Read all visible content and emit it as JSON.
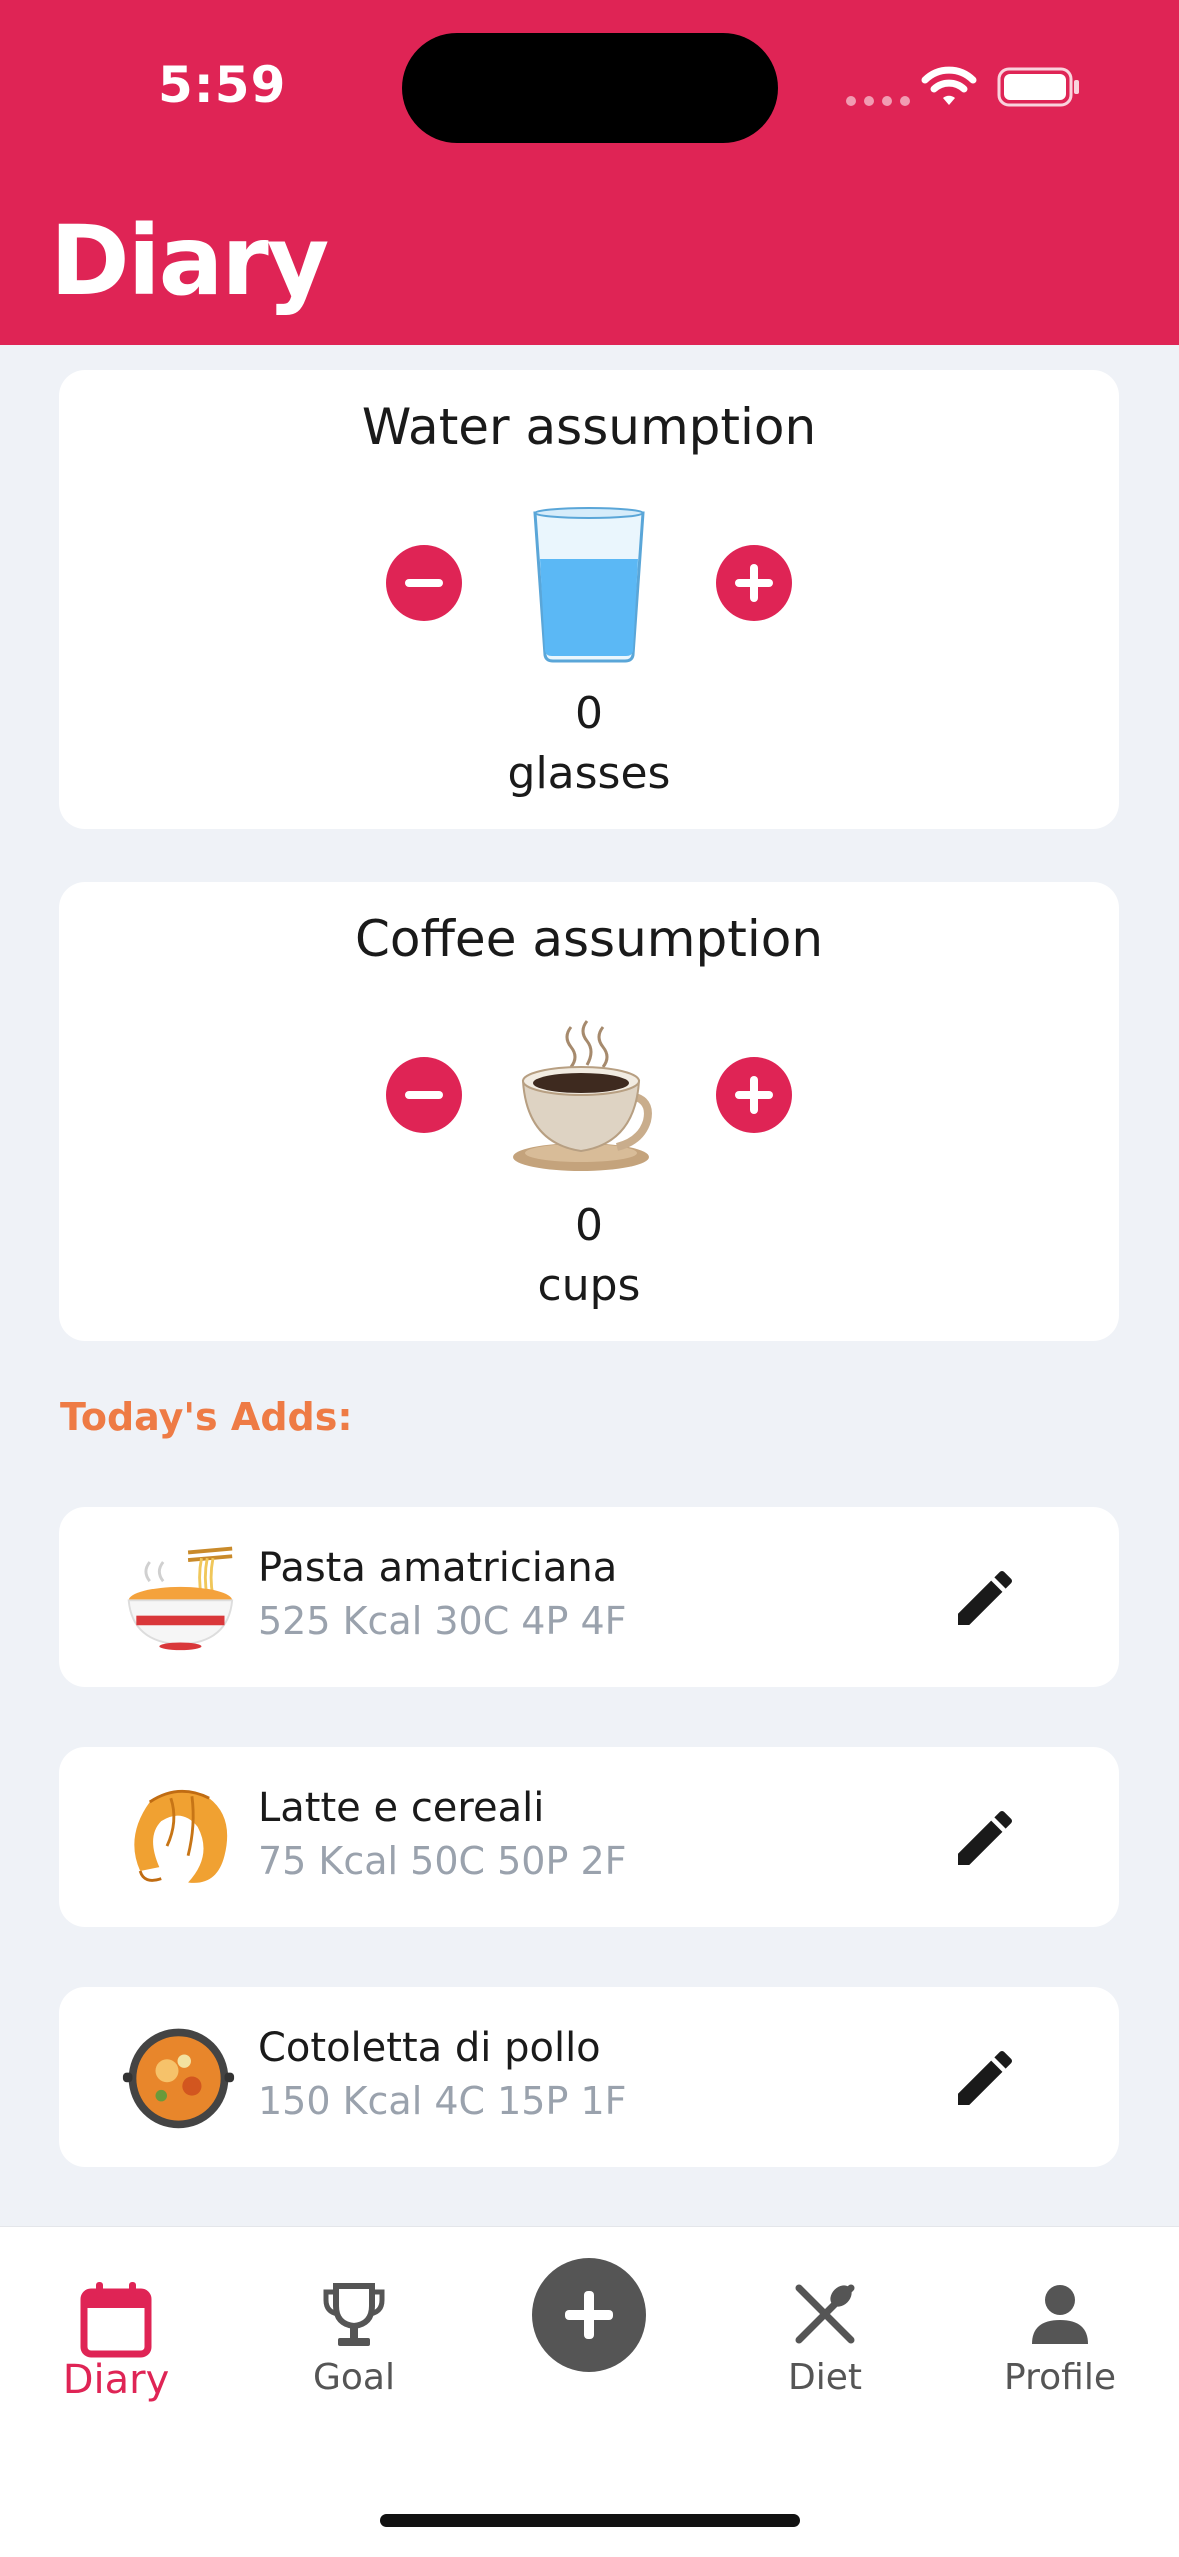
{
  "status_bar": {
    "time": "5:59"
  },
  "header": {
    "title": "Diary"
  },
  "water": {
    "title": "Water assumption",
    "count": "0",
    "unit": "glasses"
  },
  "coffee": {
    "title": "Coffee assumption",
    "count": "0",
    "unit": "cups"
  },
  "todays_adds": {
    "label": "Today's Adds:",
    "items": [
      {
        "name": "Pasta amatriciana",
        "macros": "525 Kcal 30C 4P 4F",
        "icon": "noodle-bowl-icon"
      },
      {
        "name": "Latte e cereali",
        "macros": "75 Kcal 50C 50P 2F",
        "icon": "croissant-icon"
      },
      {
        "name": "Cotoletta di pollo",
        "macros": "150 Kcal 4C 15P 1F",
        "icon": "paella-pan-icon"
      }
    ]
  },
  "tabbar": {
    "items": [
      {
        "label": "Diary",
        "icon": "calendar-icon",
        "active": true
      },
      {
        "label": "Goal",
        "icon": "trophy-icon",
        "active": false
      },
      {
        "label": "",
        "icon": "plus-icon",
        "active": false
      },
      {
        "label": "Diet",
        "icon": "fork-knife-icon",
        "active": false
      },
      {
        "label": "Profile",
        "icon": "person-icon",
        "active": false
      }
    ]
  },
  "colors": {
    "accent": "#df2455",
    "section_label": "#ee7b45",
    "macros_text": "#9aa2ad",
    "background": "#eff2f7"
  }
}
